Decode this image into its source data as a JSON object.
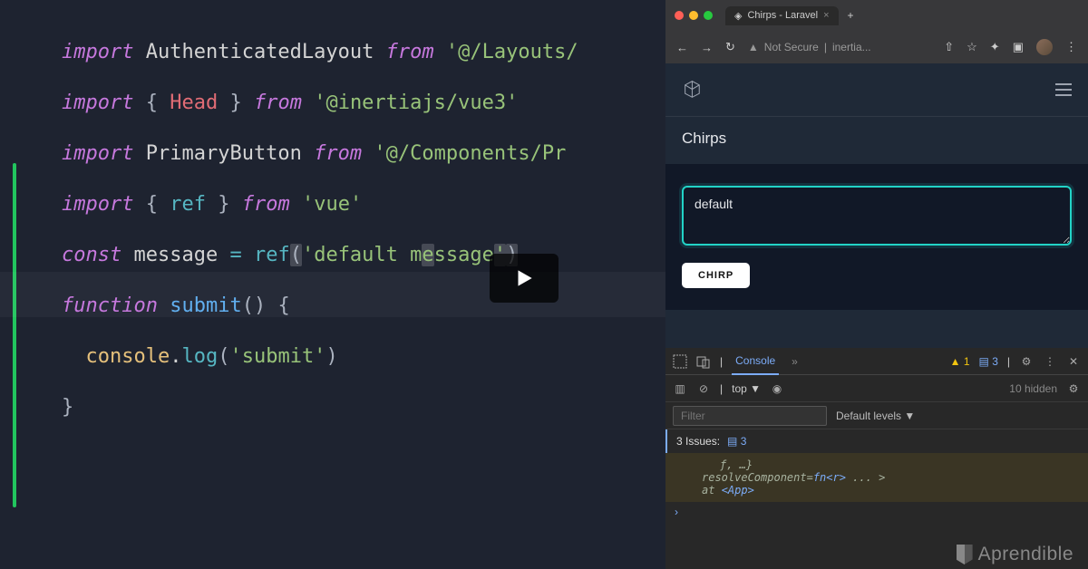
{
  "code": {
    "l1": {
      "import": "import",
      "ident": "AuthenticatedLayout",
      "from": "from",
      "str": "'@/Layouts/"
    },
    "l2": {
      "import": "import",
      "lb": "{ ",
      "named": "Head",
      "rb": " }",
      "from": "from",
      "str": "'@inertiajs/vue3'"
    },
    "l3": {
      "import": "import",
      "ident": "PrimaryButton",
      "from": "from",
      "str": "'@/Components/Pr"
    },
    "l4": {
      "import": "import",
      "lb": "{ ",
      "ref": "ref",
      "rb": " }",
      "from": "from",
      "str": "'vue'"
    },
    "l5": {
      "const": "const",
      "ident": "message",
      "eq": "=",
      "ref": "ref",
      "open": "(",
      "s1": "'default m",
      "s2": "e",
      "s3": "ssage",
      "s4": "'",
      "close": ")"
    },
    "l6": {
      "func": "function",
      "name": "submit",
      "parens": "()",
      "brace": " {"
    },
    "l7": {
      "indent": "  ",
      "obj": "console",
      "dot": ".",
      "method": "log",
      "open": "(",
      "str": "'submit'",
      "close": ")"
    },
    "l8": {
      "brace": "}"
    }
  },
  "browser": {
    "tab_title": "Chirps - Laravel",
    "not_secure": "Not Secure",
    "url": "inertia...",
    "page_title": "Chirps",
    "textarea_value": "default",
    "button_label": "CHIRP"
  },
  "devtools": {
    "tab_console": "Console",
    "more": "»",
    "warn_count": "1",
    "info_count": "3",
    "context": "top",
    "filter_placeholder": "Filter",
    "levels_label": "Default levels ▼",
    "hidden_label": "10 hidden",
    "issues_label": "3 Issues:",
    "issues_count": "3",
    "out_l0": "ƒ, …}",
    "out_l1a": "resolveComponent=",
    "out_l1b": "fn<r>",
    "out_l1c": "  ... >",
    "out_l2a": "   at ",
    "out_l2b": "<App>",
    "prompt": "›"
  },
  "watermark": "Aprendible"
}
